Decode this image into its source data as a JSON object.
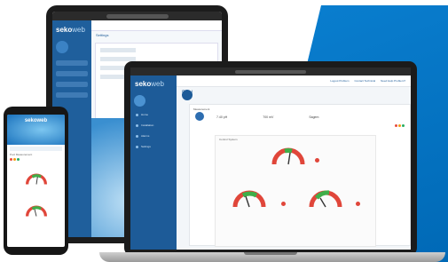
{
  "brand": {
    "name": "seko",
    "suffix": "web"
  },
  "laptop": {
    "page_title": "Pool",
    "top_links": [
      "Logout Problem",
      "Contact Technical",
      "Need Help Problem?"
    ],
    "nav_items": [
      "Home",
      "Installation",
      "Alarms",
      "Settings"
    ],
    "card_title": "Measurement",
    "stats": [
      "7.40 pH",
      "700 mV",
      "Sagem"
    ],
    "inner_title": "Control System",
    "gauge_labels": [
      "pH",
      "Cl",
      "Temp",
      "Rx"
    ]
  },
  "tablet": {
    "section_title": "Settings"
  },
  "phone": {
    "title": "sekoweb",
    "caption": "Pool Measurement"
  },
  "colors": {
    "brand": "#1d5b98",
    "accent": "#0a7fd0"
  }
}
